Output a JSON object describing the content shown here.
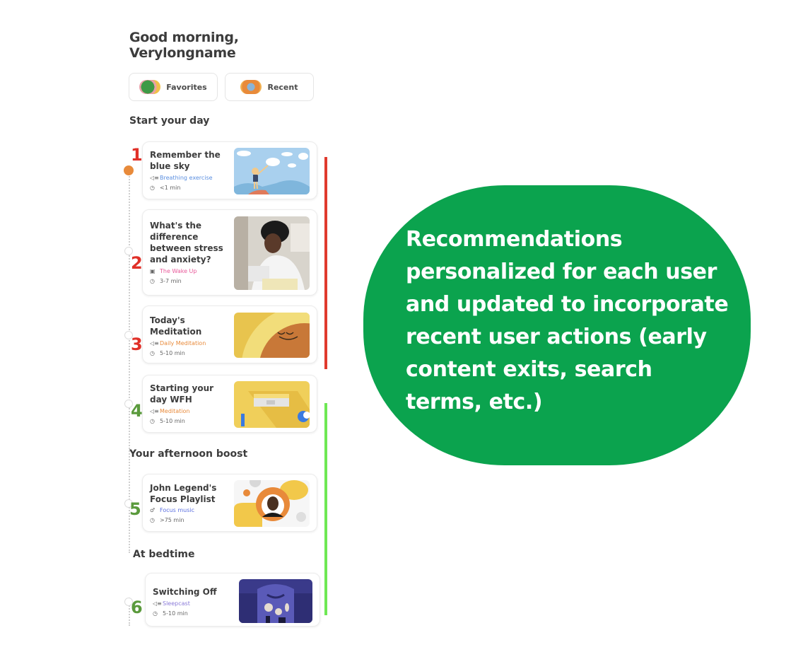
{
  "greeting": {
    "line1": "Good morning,",
    "line2": "Verylongname"
  },
  "quick_links": [
    {
      "label": "Favorites",
      "icon": "favorites-collage-icon"
    },
    {
      "label": "Recent",
      "icon": "recent-collage-icon"
    }
  ],
  "sections": [
    {
      "title": "Start your day"
    },
    {
      "title": "Your afternoon boost"
    },
    {
      "title": "At bedtime"
    }
  ],
  "cards": [
    {
      "number": "1",
      "number_color": "#e03028",
      "title": "Remember the blue sky",
      "type_icon": "audio-icon",
      "category": "Breathing exercise",
      "category_color": "#5b8fe0",
      "duration": "<1 min",
      "thumb": "girl-reaching-clouds"
    },
    {
      "number": "2",
      "number_color": "#e03028",
      "title": "What's the difference between stress and anxiety?",
      "type_icon": "video-icon",
      "category": "The Wake Up",
      "category_color": "#e85a9a",
      "duration": "3-7 min",
      "thumb": "person-at-laptop"
    },
    {
      "number": "3",
      "number_color": "#e03028",
      "title": "Today's Meditation",
      "type_icon": "audio-icon",
      "category": "Daily Meditation",
      "category_color": "#e88a3a",
      "duration": "5-10 min",
      "thumb": "sleeping-sun-face"
    },
    {
      "number": "4",
      "number_color": "#5a9a3c",
      "title": "Starting your day WFH",
      "type_icon": "audio-icon",
      "category": "Meditation",
      "category_color": "#e88a3a",
      "duration": "5-10 min",
      "thumb": "desk-workspace"
    },
    {
      "number": "5",
      "number_color": "#5a9a3c",
      "title": "John Legend's Focus Playlist",
      "type_icon": "music-icon",
      "category": "Focus music",
      "category_color": "#5b6fe0",
      "duration": ">75 min",
      "thumb": "john-legend-portrait"
    },
    {
      "number": "6",
      "number_color": "#5a9a3c",
      "title": "Switching Off",
      "type_icon": "audio-icon",
      "category": "Sleepcast",
      "category_color": "#8a7ad8",
      "duration": "5-10 min",
      "thumb": "purple-night-scene"
    }
  ],
  "annotation": {
    "text": "Recommendations personalized for each user and updated to incorporate recent user actions (early content exits, search terms, etc.)",
    "background": "#0ba34e",
    "red_bar_color": "#e03a2e",
    "green_bar_color": "#6ee854"
  }
}
